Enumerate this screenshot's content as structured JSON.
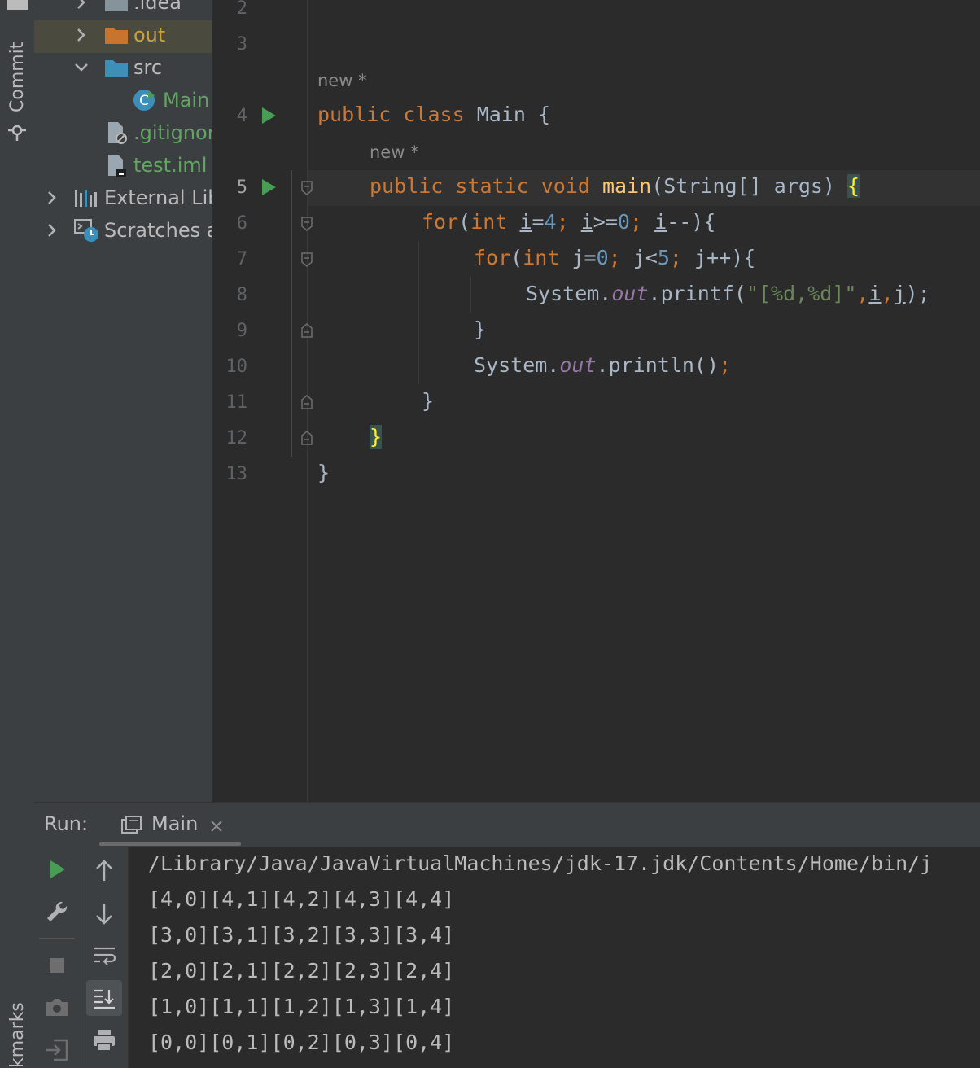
{
  "side_strip": {
    "commit_label": "Commit",
    "bookmarks_label": "kmarks"
  },
  "project_tree": {
    "items": [
      {
        "label": ".idea"
      },
      {
        "label": "out"
      },
      {
        "label": "src"
      },
      {
        "label": "Main"
      },
      {
        "label": ".gitignore"
      },
      {
        "label": "test.iml"
      },
      {
        "label": "External Libraries"
      },
      {
        "label": "Scratches and Consoles"
      }
    ]
  },
  "editor": {
    "line_numbers": [
      "2",
      "3",
      "4",
      "5",
      "6",
      "7",
      "8",
      "9",
      "10",
      "11",
      "12",
      "13"
    ],
    "hints": [
      "new *",
      "new *"
    ],
    "code": {
      "l4_public": "public",
      "l4_class": "class",
      "l4_rest": " Main {",
      "l5_mods": "public static void ",
      "l5_main": "main",
      "l5_args": "(String[] args) ",
      "l5_brace": "{",
      "l6_for": "for",
      "l6_p": "(",
      "l6_int": "int ",
      "l6_i": "i",
      "l6_eq": "=",
      "l6_4": "4",
      "l6_s1": "; ",
      "l6_i2": "i",
      "l6_ge": ">=",
      "l6_0": "0",
      "l6_s2": "; ",
      "l6_i3": "i",
      "l6_dec": "--){",
      "l7_for": "for",
      "l7_p": "(",
      "l7_int": "int ",
      "l7_j": "j",
      "l7_eq": "=",
      "l7_0": "0",
      "l7_s1": "; ",
      "l7_j2": "j",
      "l7_lt": "<",
      "l7_5": "5",
      "l7_s2": "; ",
      "l7_j3": "j",
      "l7_inc": "++){",
      "l8_sys": "System.",
      "l8_out": "out",
      "l8_printf": ".printf(",
      "l8_str": "\"[%d,%d]\"",
      "l8_c1": ",",
      "l8_i": "i",
      "l8_c2": ",",
      "l8_j": "j",
      "l8_end": ");",
      "l9": "}",
      "l10_sys": "System.",
      "l10_out": "out",
      "l10_rest": ".println()",
      "l10_semi": ";",
      "l11": "}",
      "l12": "}",
      "l13": "}"
    }
  },
  "run_panel": {
    "label": "Run:",
    "tab": "Main",
    "output": [
      "/Library/Java/JavaVirtualMachines/jdk-17.jdk/Contents/Home/bin/j",
      "[4,0][4,1][4,2][4,3][4,4]",
      "[3,0][3,1][3,2][3,3][3,4]",
      "[2,0][2,1][2,2][2,3][2,4]",
      "[1,0][1,1][1,2][1,3][1,4]",
      "[0,0][0,1][0,2][0,3][0,4]"
    ]
  },
  "colors": {
    "keyword": "#cc7832",
    "number": "#6897bb",
    "string": "#6a8759",
    "field": "#9876aa",
    "method": "#ffc66d",
    "run_green": "#499c54"
  }
}
